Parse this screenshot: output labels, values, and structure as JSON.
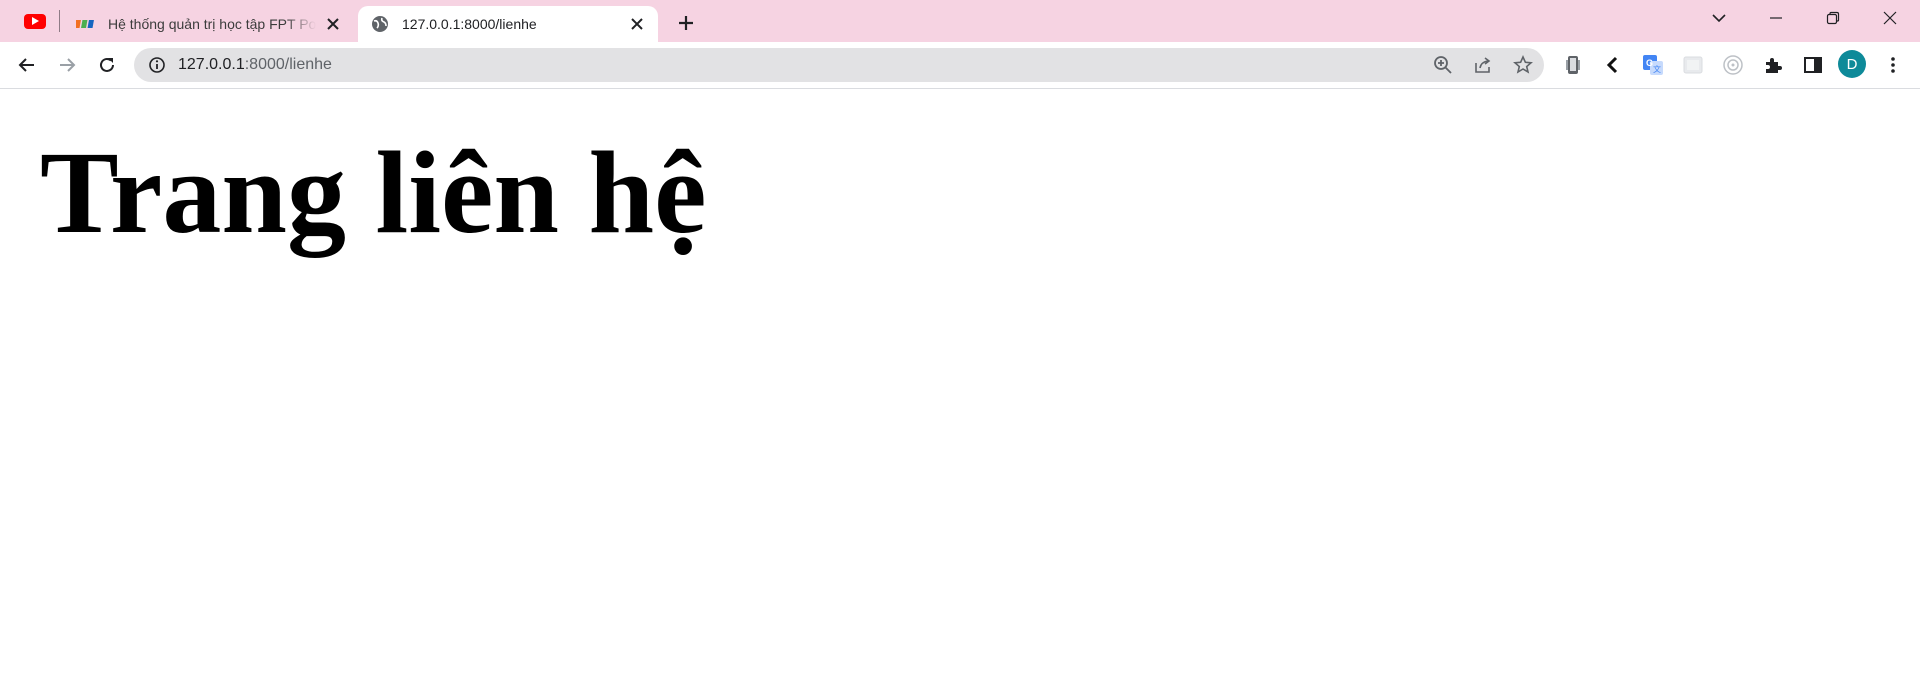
{
  "browser": {
    "tabs": [
      {
        "title": "Hệ thống quản trị học tập FPT Polytechnic",
        "favicon": "fpt-logo-icon",
        "active": false
      },
      {
        "title": "127.0.0.1:8000/lienhe",
        "favicon": "globe-icon",
        "active": true
      }
    ],
    "pinned_tab": {
      "favicon": "youtube-icon"
    },
    "address_bar": {
      "host": "127.0.0.1",
      "path": ":8000/lienhe"
    },
    "profile_initial": "D",
    "colors": {
      "tabstrip": "#f6d3e2",
      "omnibox": "#e2e2e4",
      "avatar": "#0e8a99",
      "youtube": "#ff0000"
    }
  },
  "page": {
    "heading": "Trang liên hệ"
  }
}
